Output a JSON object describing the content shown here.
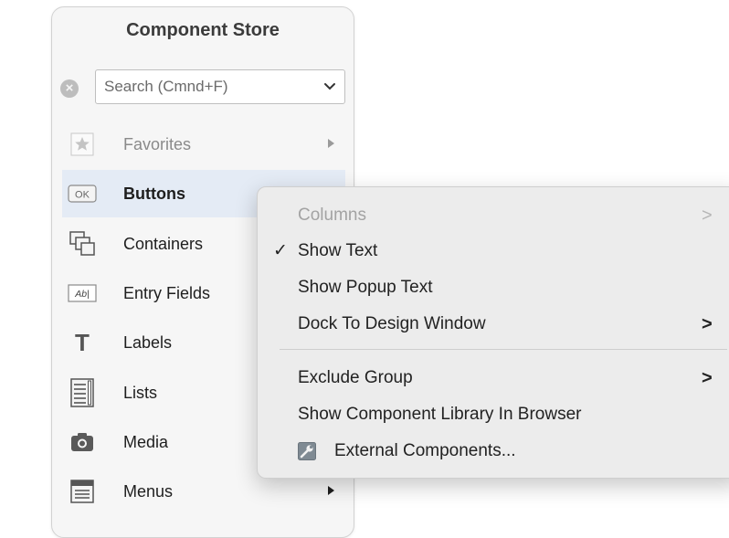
{
  "panel": {
    "title": "Component Store",
    "search": {
      "placeholder": "Search (Cmnd+F)"
    },
    "categories": [
      {
        "label": "Favorites",
        "icon": "star-icon"
      },
      {
        "label": "Buttons",
        "icon": "ok-button-icon",
        "icon_text": "OK"
      },
      {
        "label": "Containers",
        "icon": "stacked-windows-icon"
      },
      {
        "label": "Entry Fields",
        "icon": "text-field-icon",
        "icon_text": "Ab|"
      },
      {
        "label": "Labels",
        "icon": "text-t-icon",
        "icon_text": "T"
      },
      {
        "label": "Lists",
        "icon": "list-icon"
      },
      {
        "label": "Media",
        "icon": "camera-icon"
      },
      {
        "label": "Menus",
        "icon": "menu-window-icon"
      }
    ]
  },
  "context_menu": {
    "items": [
      {
        "label": "Columns",
        "submenu_arrow": ">"
      },
      {
        "label": "Show Text",
        "checkmark": "✓"
      },
      {
        "label": "Show Popup Text"
      },
      {
        "label": "Dock To Design Window",
        "submenu_arrow": ">"
      },
      {
        "label": "Exclude Group",
        "submenu_arrow": ">"
      },
      {
        "label": "Show Component Library In Browser"
      },
      {
        "label": "External Components...",
        "icon": "wrench-icon"
      }
    ]
  },
  "colors": {
    "selected_row": "#e4ebf5",
    "menu_bg": "#ececec",
    "panel_bg": "#f6f6f6"
  }
}
